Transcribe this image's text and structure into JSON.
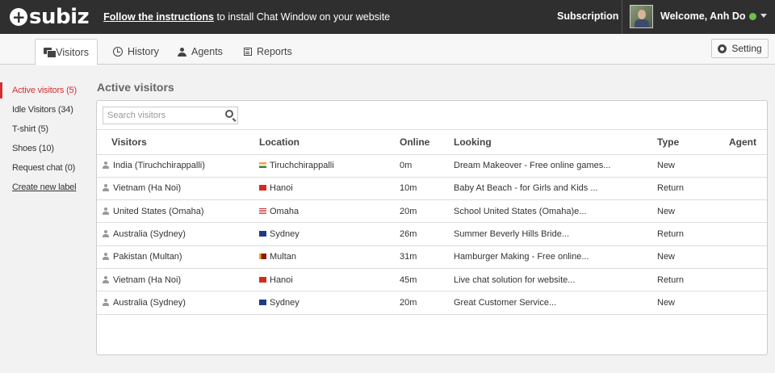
{
  "header": {
    "logo": "subiz",
    "install_link": "Follow the instructions",
    "install_rest": " to install Chat Window on your website",
    "subscription": "Subscription",
    "welcome": "Welcome, Anh Do",
    "status_color": "#6cc04a"
  },
  "tabs": [
    {
      "label": "Visitors",
      "icon": "chat-icon",
      "active": true
    },
    {
      "label": "History",
      "icon": "clock-icon"
    },
    {
      "label": "Agents",
      "icon": "user-icon"
    },
    {
      "label": "Reports",
      "icon": "report-icon"
    }
  ],
  "setting_label": "Setting",
  "sidebar": {
    "items": [
      {
        "label": "Active visitors (5)",
        "active": true
      },
      {
        "label": "Idle Visitors (34)"
      },
      {
        "label": "T-shirt (5)"
      },
      {
        "label": "Shoes (10)"
      },
      {
        "label": "Request chat (0)"
      },
      {
        "label": "Create new label",
        "link": true
      }
    ]
  },
  "main": {
    "title": "Active visitors",
    "search_placeholder": "Search visitors",
    "columns": [
      "Visitors",
      "Location",
      "Online",
      "Looking",
      "Type",
      "Agent"
    ],
    "rows": [
      {
        "visitor": "India (Tiruchchirappalli)",
        "flag": "india",
        "location": "Tiruchchirappalli",
        "online": "0m",
        "looking": "Dream Makeover - Free online games...",
        "type": "New",
        "agent": ""
      },
      {
        "visitor": "Vietnam (Ha Noi)",
        "flag": "vietnam",
        "location": "Hanoi",
        "online": "10m",
        "looking": "Baby At Beach -  for Girls and Kids ...",
        "type": "Return",
        "agent": ""
      },
      {
        "visitor": "United States (Omaha)",
        "flag": "usa",
        "location": "Omaha",
        "online": "20m",
        "looking": "School United States (Omaha)e...",
        "type": "New",
        "agent": ""
      },
      {
        "visitor": "Australia (Sydney)",
        "flag": "australia",
        "location": "Sydney",
        "online": "26m",
        "looking": "Summer Beverly Hills Bride...",
        "type": "Return",
        "agent": ""
      },
      {
        "visitor": "Pakistan (Multan)",
        "flag": "srilanka",
        "location": "Multan",
        "online": "31m",
        "looking": "Hamburger Making - Free online...",
        "type": "New",
        "agent": ""
      },
      {
        "visitor": "Vietnam (Ha Noi)",
        "flag": "vietnam",
        "location": "Hanoi",
        "online": "45m",
        "looking": "Live chat solution for website...",
        "type": "Return",
        "agent": ""
      },
      {
        "visitor": "Australia (Sydney)",
        "flag": "australia",
        "location": "Sydney",
        "online": "20m",
        "looking": "Great Customer Service...",
        "type": "New",
        "agent": ""
      }
    ]
  },
  "colors": {
    "topbar": "#2f2f2f",
    "active_red": "#d32f2f"
  }
}
